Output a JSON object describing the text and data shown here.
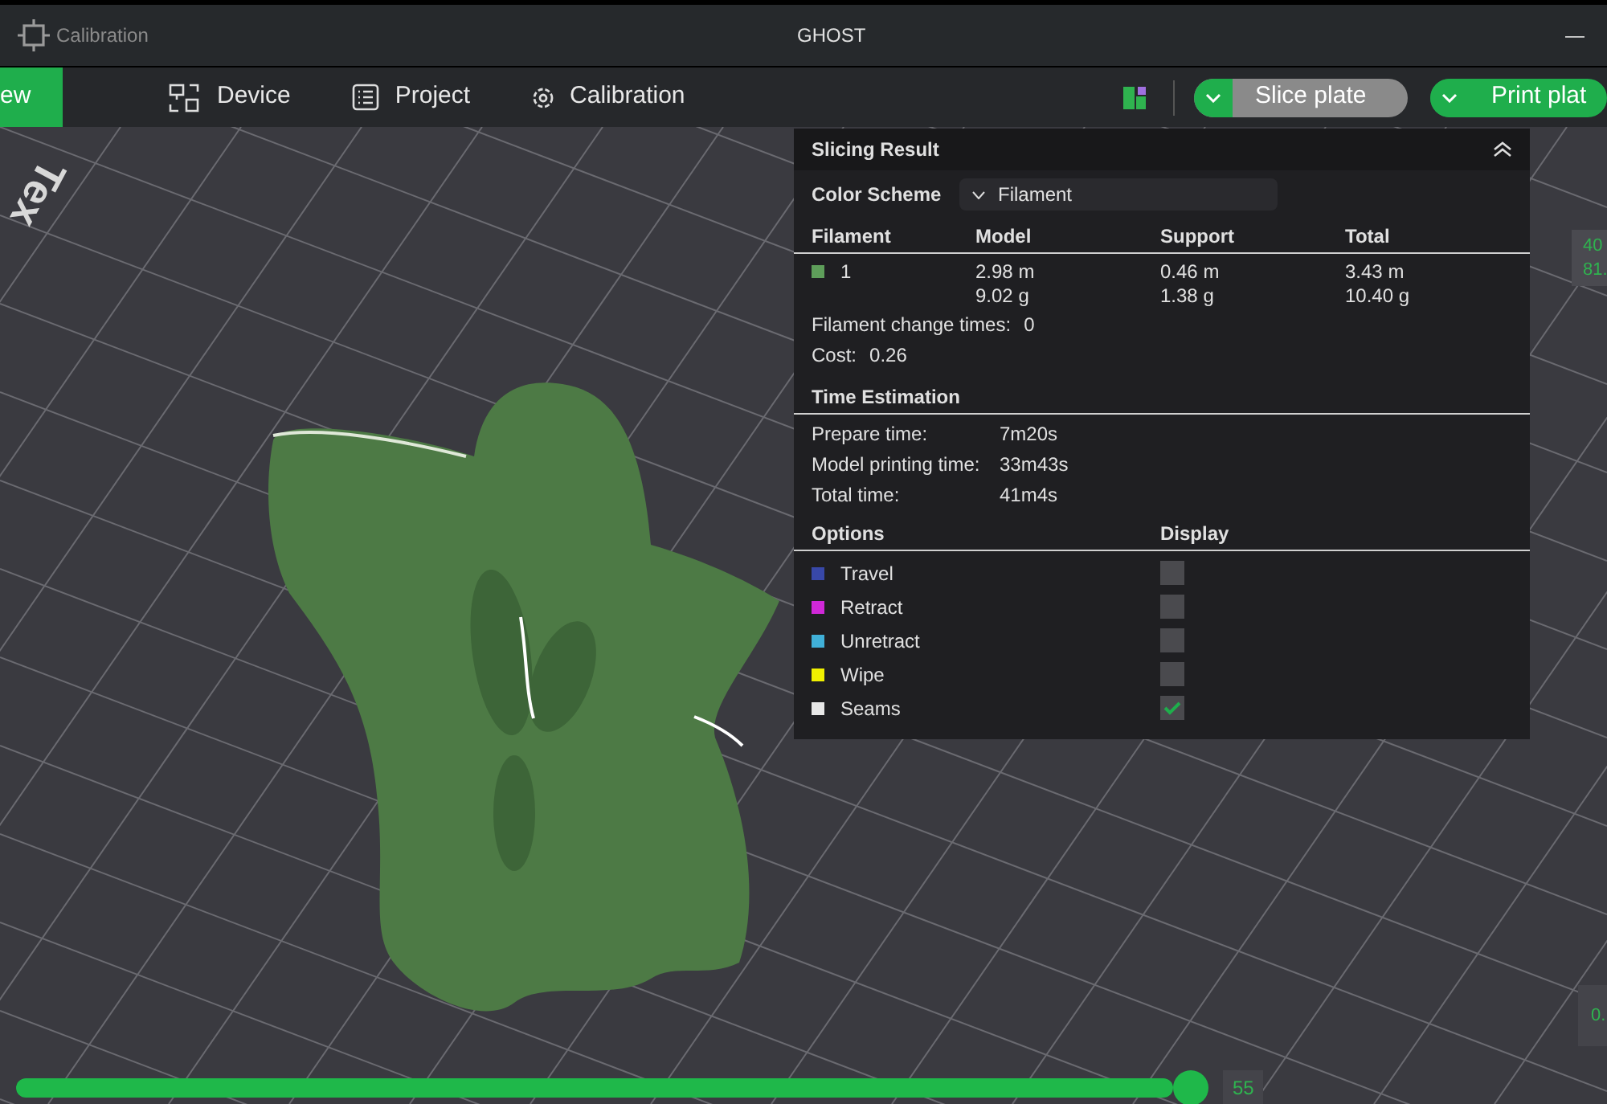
{
  "title_bar": {
    "subtitle": "Calibration",
    "title": "GHOST",
    "minimize": "—"
  },
  "tabs": [
    {
      "label": "ew",
      "selected": true
    },
    {
      "label": "Device",
      "selected": false
    },
    {
      "label": "Project",
      "selected": false
    },
    {
      "label": "Calibration",
      "selected": false
    }
  ],
  "toolbar": {
    "buttons": [
      {
        "label": "Slice plate",
        "kind": "secondary"
      },
      {
        "label": "Print plat",
        "kind": "primary"
      }
    ]
  },
  "viewport": {
    "bed_text": "Tex",
    "readouts": [
      {
        "lines": [
          "40",
          "81."
        ]
      },
      {
        "lines": [
          "0."
        ]
      }
    ]
  },
  "slicing_result": {
    "title": "Slicing Result",
    "color_scheme": {
      "label": "Color Scheme",
      "value": "Filament"
    },
    "filament_table": {
      "columns": [
        "Filament",
        "Model",
        "Support",
        "Total"
      ],
      "rows": [
        {
          "color": "#5e9e5a",
          "id": "1",
          "model": [
            "2.98 m",
            "9.02 g"
          ],
          "support": [
            "0.46 m",
            "1.38 g"
          ],
          "total": [
            "3.43 m",
            "10.40 g"
          ]
        }
      ]
    },
    "stats": [
      {
        "label": "Filament change times:",
        "value": "0"
      },
      {
        "label": "Cost:",
        "value": "0.26"
      }
    ],
    "time_estimation": {
      "title": "Time Estimation",
      "rows": [
        {
          "label": "Prepare time:",
          "value": "7m20s"
        },
        {
          "label": "Model printing time:",
          "value": "33m43s"
        },
        {
          "label": "Total time:",
          "value": "41m4s"
        }
      ]
    },
    "options": {
      "columns": [
        "Options",
        "Display"
      ],
      "items": [
        {
          "label": "Travel",
          "color": "#3848a8",
          "checked": false
        },
        {
          "label": "Retract",
          "color": "#d028d8",
          "checked": false
        },
        {
          "label": "Unretract",
          "color": "#40b0d8",
          "checked": false
        },
        {
          "label": "Wipe",
          "color": "#f0f000",
          "checked": false
        },
        {
          "label": "Seams",
          "color": "#e8e8e8",
          "checked": true
        }
      ]
    }
  },
  "layer_slider": {
    "level": 1,
    "value": "55"
  }
}
